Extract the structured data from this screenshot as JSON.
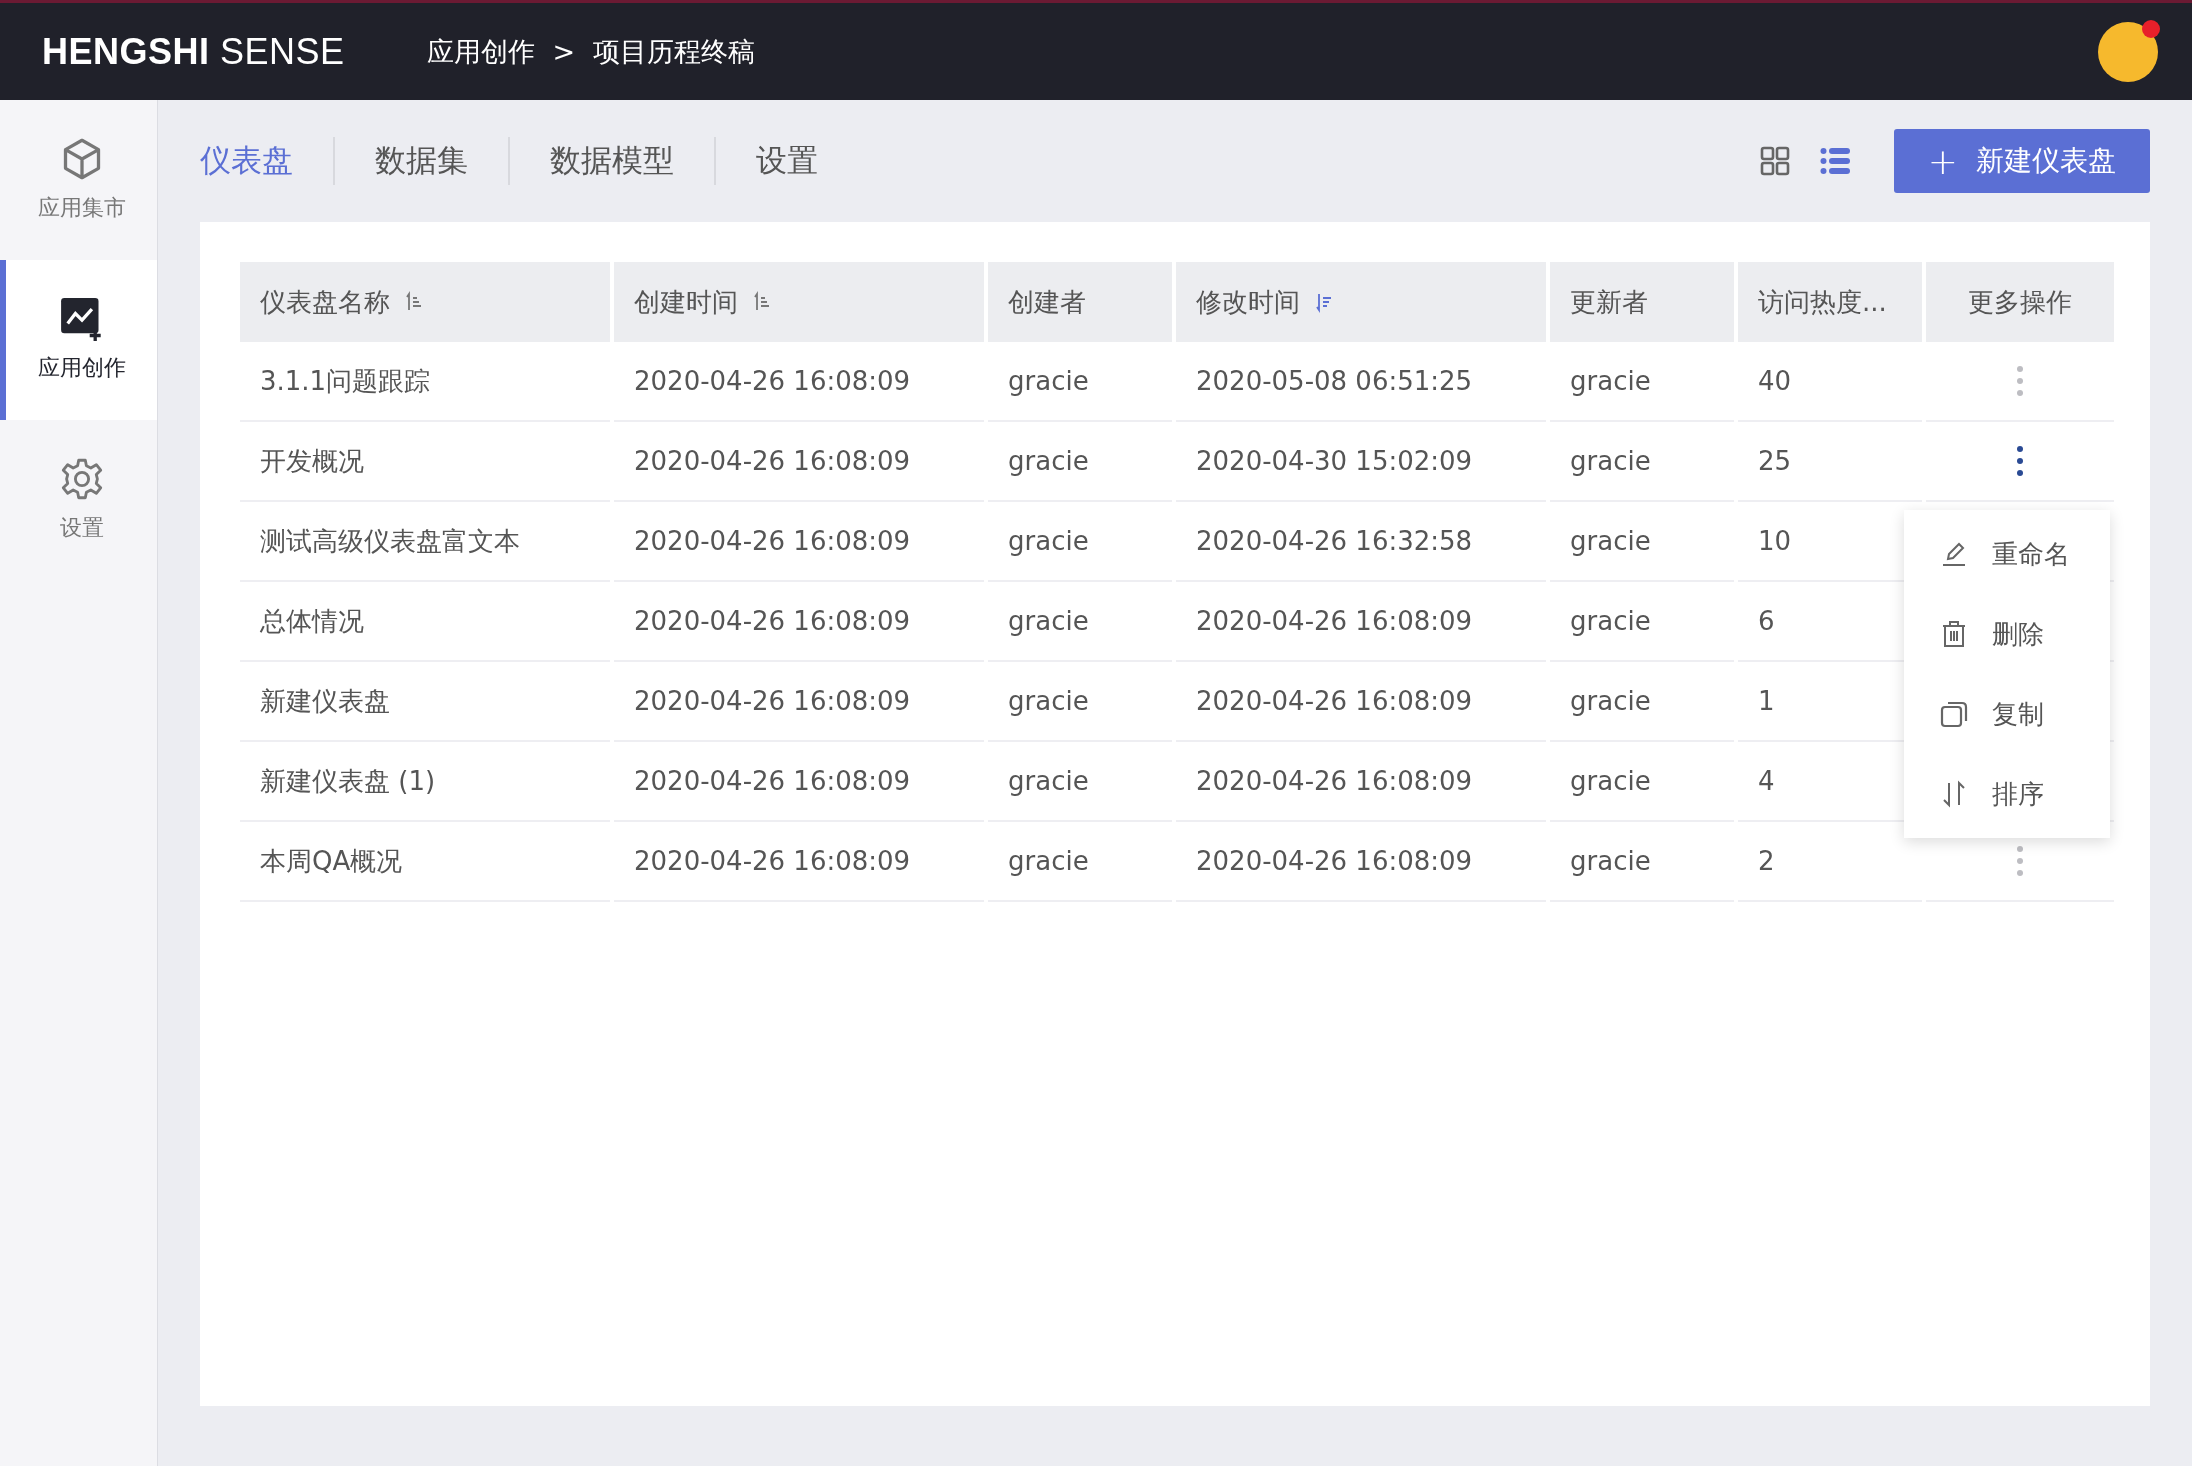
{
  "header": {
    "brand_bold": "HENGSHI",
    "brand_light": "SENSE",
    "breadcrumb": [
      {
        "label": "应用创作"
      },
      {
        "label": "项目历程终稿"
      }
    ],
    "breadcrumb_separator": ">"
  },
  "sidebar": {
    "items": [
      {
        "label": "应用集市",
        "kind": "cube",
        "selected": false
      },
      {
        "label": "应用创作",
        "kind": "chart",
        "selected": true
      },
      {
        "label": "设置",
        "kind": "gear",
        "selected": false
      }
    ]
  },
  "tabs": [
    {
      "label": "仪表盘",
      "selected": true
    },
    {
      "label": "数据集",
      "selected": false
    },
    {
      "label": "数据模型",
      "selected": false
    },
    {
      "label": "设置",
      "selected": false
    }
  ],
  "view_toggle": [
    {
      "kind": "grid",
      "selected": false
    },
    {
      "kind": "list",
      "selected": true
    }
  ],
  "new_button": {
    "icon": "+",
    "label": "新建仪表盘"
  },
  "table": {
    "columns": [
      {
        "label": "仪表盘名称",
        "sorted": false
      },
      {
        "label": "创建时间",
        "sorted": false
      },
      {
        "label": "创建者"
      },
      {
        "label": "修改时间",
        "sorted": true
      },
      {
        "label": "更新者"
      },
      {
        "label": "访问热度..."
      },
      {
        "label": "更多操作"
      }
    ],
    "rows": [
      {
        "cells": [
          "3.1.1问题跟踪",
          "2020-04-26 16:08:09",
          "gracie",
          "2020-05-08 06:51:25",
          "gracie",
          "40"
        ],
        "menu_open": false
      },
      {
        "cells": [
          "开发概况",
          "2020-04-26 16:08:09",
          "gracie",
          "2020-04-30 15:02:09",
          "gracie",
          "25"
        ],
        "menu_open": true
      },
      {
        "cells": [
          "测试高级仪表盘富文本",
          "2020-04-26 16:08:09",
          "gracie",
          "2020-04-26 16:32:58",
          "gracie",
          "10"
        ],
        "menu_open": false
      },
      {
        "cells": [
          "总体情况",
          "2020-04-26 16:08:09",
          "gracie",
          "2020-04-26 16:08:09",
          "gracie",
          "6"
        ],
        "menu_open": false
      },
      {
        "cells": [
          "新建仪表盘",
          "2020-04-26 16:08:09",
          "gracie",
          "2020-04-26 16:08:09",
          "gracie",
          "1"
        ],
        "menu_open": false
      },
      {
        "cells": [
          "新建仪表盘 (1)",
          "2020-04-26 16:08:09",
          "gracie",
          "2020-04-26 16:08:09",
          "gracie",
          "4"
        ],
        "menu_open": false
      },
      {
        "cells": [
          "本周QA概况",
          "2020-04-26 16:08:09",
          "gracie",
          "2020-04-26 16:08:09",
          "gracie",
          "2"
        ],
        "menu_open": false
      }
    ]
  },
  "context_menu": [
    {
      "kind": "rename",
      "label": "重命名"
    },
    {
      "kind": "delete",
      "label": "删除"
    },
    {
      "kind": "copy",
      "label": "复制"
    },
    {
      "kind": "sort",
      "label": "排序"
    }
  ]
}
